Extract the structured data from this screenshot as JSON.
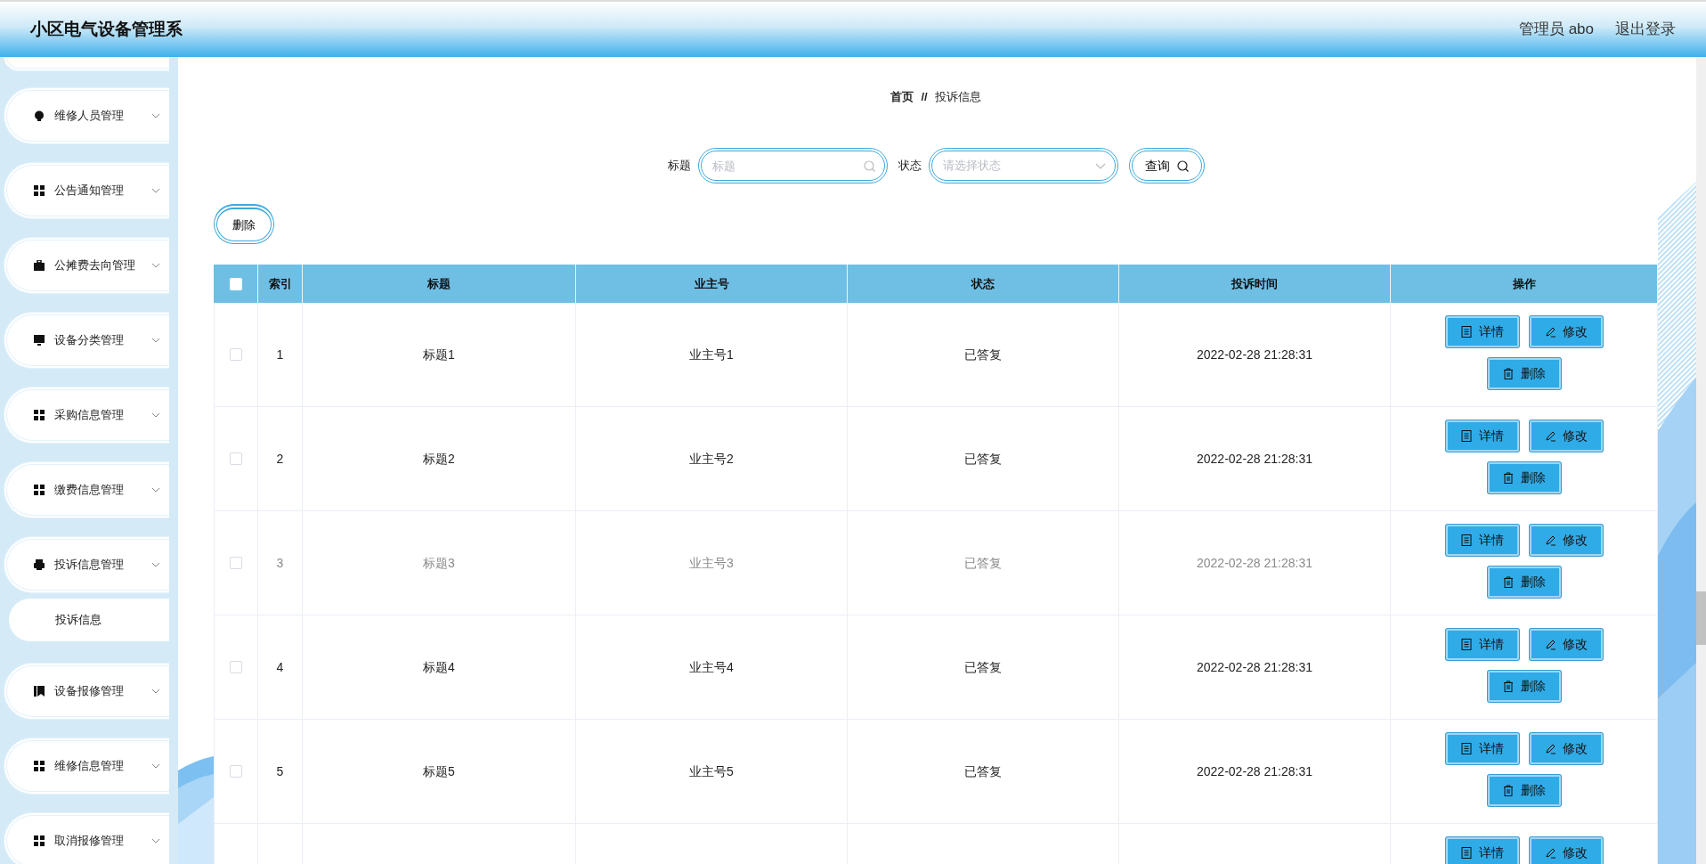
{
  "header": {
    "title": "小区电气设备管理系",
    "user": "管理员 abo",
    "logout": "退出登录"
  },
  "sidebar": {
    "items": [
      {
        "label": "维修人员管理"
      },
      {
        "label": "公告通知管理"
      },
      {
        "label": "公摊费去向管理"
      },
      {
        "label": "设备分类管理"
      },
      {
        "label": "采购信息管理"
      },
      {
        "label": "缴费信息管理"
      },
      {
        "label": "投诉信息管理",
        "children": [
          {
            "label": "投诉信息",
            "selected": true
          }
        ]
      },
      {
        "label": "设备报修管理"
      },
      {
        "label": "维修信息管理"
      },
      {
        "label": "取消报修管理"
      }
    ]
  },
  "breadcrumb": {
    "home": "首页",
    "separator": "//",
    "current": "投诉信息"
  },
  "search": {
    "title_label": "标题",
    "title_placeholder": "标题",
    "status_label": "状态",
    "status_placeholder": "请选择状态",
    "query_button": "查询"
  },
  "delete_button": "删除",
  "table": {
    "select_all_checked": false,
    "columns": [
      "索引",
      "标题",
      "业主号",
      "状态",
      "投诉时间",
      "操作"
    ],
    "rows": [
      {
        "checked": false,
        "hovered": false,
        "cells": [
          "1",
          "标题1",
          "业主号1",
          "已答复",
          "2022-02-28 21:28:31"
        ],
        "actions": [
          {
            "kind": "detail",
            "label": "详情"
          },
          {
            "kind": "edit",
            "label": "修改"
          },
          {
            "kind": "delete",
            "label": "删除"
          }
        ]
      },
      {
        "checked": false,
        "hovered": false,
        "cells": [
          "2",
          "标题2",
          "业主号2",
          "已答复",
          "2022-02-28 21:28:31"
        ],
        "actions": [
          {
            "kind": "detail",
            "label": "详情"
          },
          {
            "kind": "edit",
            "label": "修改"
          },
          {
            "kind": "delete",
            "label": "删除"
          }
        ]
      },
      {
        "checked": false,
        "hovered": true,
        "cells": [
          "3",
          "标题3",
          "业主号3",
          "已答复",
          "2022-02-28 21:28:31"
        ],
        "actions": [
          {
            "kind": "detail",
            "label": "详情"
          },
          {
            "kind": "edit",
            "label": "修改"
          },
          {
            "kind": "delete",
            "label": "删除"
          }
        ]
      },
      {
        "checked": false,
        "hovered": false,
        "cells": [
          "4",
          "标题4",
          "业主号4",
          "已答复",
          "2022-02-28 21:28:31"
        ],
        "actions": [
          {
            "kind": "detail",
            "label": "详情"
          },
          {
            "kind": "edit",
            "label": "修改"
          },
          {
            "kind": "delete",
            "label": "删除"
          }
        ]
      },
      {
        "checked": false,
        "hovered": false,
        "cells": [
          "5",
          "标题5",
          "业主号5",
          "已答复",
          "2022-02-28 21:28:31"
        ],
        "actions": [
          {
            "kind": "detail",
            "label": "详情"
          },
          {
            "kind": "edit",
            "label": "修改"
          },
          {
            "kind": "delete",
            "label": "删除"
          }
        ]
      },
      {
        "actions": [
          {
            "kind": "detail",
            "label": "详情"
          },
          {
            "kind": "edit",
            "label": "修改"
          }
        ]
      }
    ]
  }
}
